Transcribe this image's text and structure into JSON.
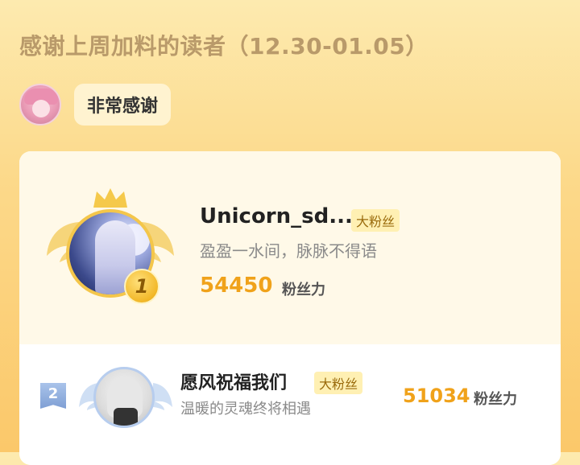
{
  "header": {
    "title": "感谢上周加料的读者（12.30-01.05）"
  },
  "thanks": {
    "text": "非常感谢"
  },
  "ranking": [
    {
      "rank": "1",
      "name": "Unicorn_sd...",
      "badge": "大粉丝",
      "motto": "盈盈一水间，脉脉不得语",
      "count": "54450",
      "unit": "粉丝力"
    },
    {
      "rank": "2",
      "name": "愿风祝福我们",
      "badge": "大粉丝",
      "motto": "温暖的灵魂终将相遇",
      "count": "51034",
      "unit": "粉丝力"
    }
  ],
  "colors": {
    "accent": "#f0a21a",
    "badge_bg": "#fff0b3",
    "gold": "#f4c64a",
    "silver": "#b7cdee"
  },
  "icons": [
    "crown-icon",
    "gold-wing-icon",
    "rank-1-medal-icon",
    "rank-2-ribbon-icon",
    "silver-wing-icon"
  ]
}
